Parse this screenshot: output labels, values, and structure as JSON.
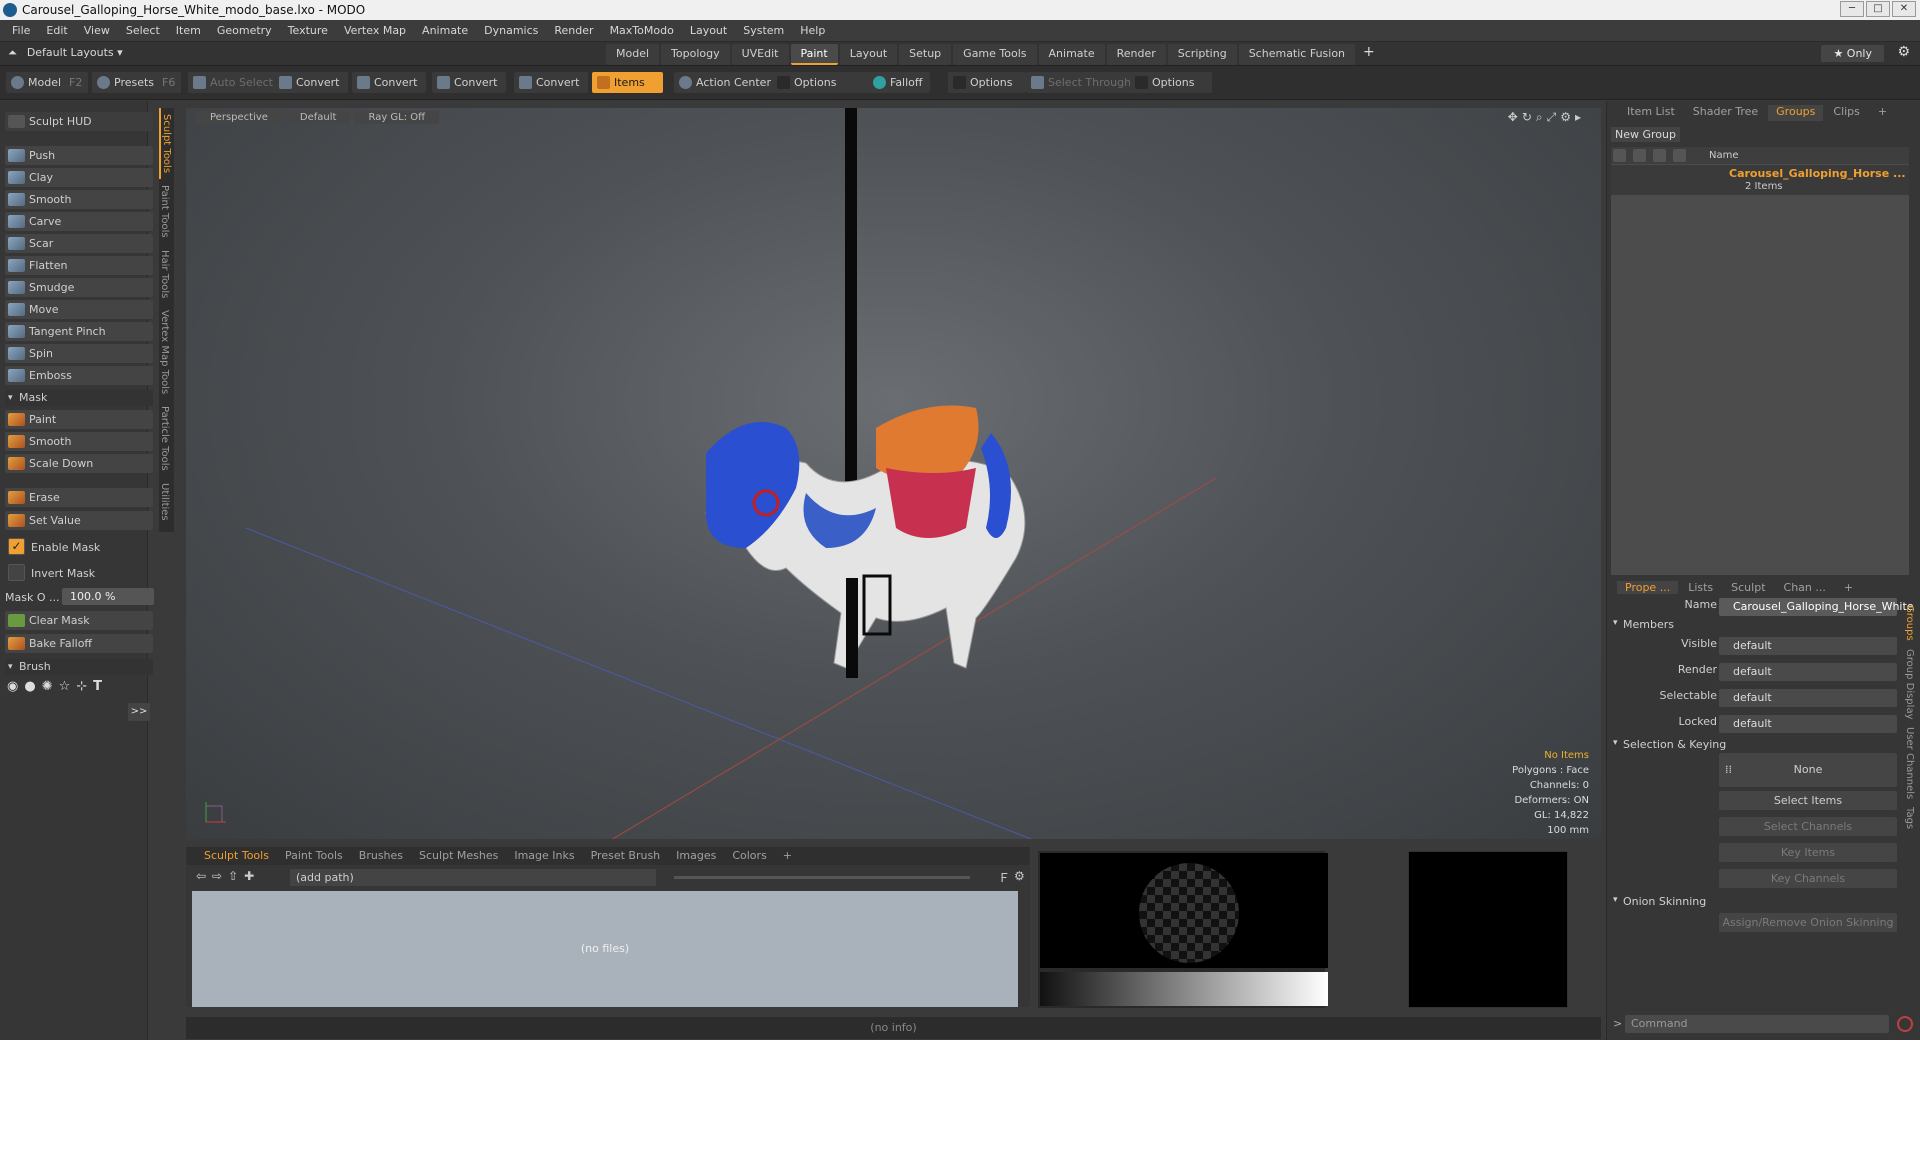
{
  "window": {
    "title": "Carousel_Galloping_Horse_White_modo_base.lxo - MODO"
  },
  "menu": [
    "File",
    "Edit",
    "View",
    "Select",
    "Item",
    "Geometry",
    "Texture",
    "Vertex Map",
    "Animate",
    "Dynamics",
    "Render",
    "MaxToModo",
    "Layout",
    "System",
    "Help"
  ],
  "layouts": {
    "label": "Default Layouts ▾"
  },
  "tabs": [
    "Model",
    "Topology",
    "UVEdit",
    "Paint",
    "Layout",
    "Setup",
    "Game Tools",
    "Animate",
    "Render",
    "Scripting",
    "Schematic Fusion"
  ],
  "active_tab": "Paint",
  "only": "★  Only",
  "toolbar": {
    "model": "Model",
    "model_key": "F2",
    "presets": "Presets",
    "presets_key": "F6",
    "auto_select": "Auto Select",
    "convert1": "Convert",
    "convert2": "Convert",
    "convert3": "Convert",
    "convert4": "Convert",
    "items": "Items",
    "action_center": "Action Center",
    "options1": "Options",
    "falloff": "Falloff",
    "options2": "Options",
    "select_through": "Select Through",
    "options3": "Options"
  },
  "sculpt": {
    "hud": "Sculpt HUD",
    "tools": [
      "Push",
      "Clay",
      "Smooth",
      "Carve",
      "Scar",
      "Flatten",
      "Smudge",
      "Move",
      "Tangent Pinch",
      "Spin",
      "Emboss"
    ],
    "mask_section": "Mask",
    "mask_tools": [
      "Paint",
      "Smooth",
      "Scale Down"
    ],
    "erase": "Erase",
    "set_value": "Set Value",
    "enable_mask": "Enable Mask",
    "invert_mask": "Invert Mask",
    "mask_opacity_label": "Mask O ...",
    "mask_opacity": "100.0 %",
    "clear_mask": "Clear Mask",
    "bake_falloff": "Bake Falloff",
    "brush_section": "Brush",
    "more": ">>"
  },
  "side_tabs": [
    "Sculpt Tools",
    "Paint Tools",
    "Hair Tools",
    "Vertex Map Tools",
    "Particle Tools",
    "Utilities"
  ],
  "viewport": {
    "view": "Perspective",
    "shading": "Default",
    "raygl": "Ray GL: Off",
    "info": [
      "No Items",
      "Polygons : Face",
      "Channels: 0",
      "Deformers: ON",
      "GL: 14,822",
      "100 mm"
    ]
  },
  "bottom": {
    "tabs": [
      "Sculpt Tools",
      "Paint Tools",
      "Brushes",
      "Sculpt Meshes",
      "Image Inks",
      "Preset Brush",
      "Images",
      "Colors",
      "+"
    ],
    "path": "(add path)",
    "files": "(no files)",
    "status": "(no info)"
  },
  "right": {
    "tabs": [
      "Item List",
      "Shader Tree",
      "Groups",
      "Clips",
      "+"
    ],
    "new_group": "New Group",
    "name_col": "Name",
    "group_name": "Carousel_Galloping_Horse ...",
    "group_count": "2 Items"
  },
  "props": {
    "tabs": [
      "Prope ...",
      "Lists",
      "Sculpt",
      "Chan ...",
      "+"
    ],
    "name_label": "Name",
    "name_value": "Carousel_Galloping_Horse_White",
    "members": "Members",
    "visible_label": "Visible",
    "visible": "default",
    "render_label": "Render",
    "render": "default",
    "selectable_label": "Selectable",
    "selectable": "default",
    "locked_label": "Locked",
    "locked": "default",
    "selection_keying": "Selection & Keying",
    "none": "None",
    "select_items": "Select Items",
    "select_channels": "Select Channels",
    "key_items": "Key Items",
    "key_channels": "Key Channels",
    "onion": "Onion Skinning",
    "assign_onion": "Assign/Remove Onion Skinning",
    "command": "Command"
  },
  "right_vtabs": [
    "Groups",
    "Group Display",
    "User Channels",
    "Tags"
  ]
}
